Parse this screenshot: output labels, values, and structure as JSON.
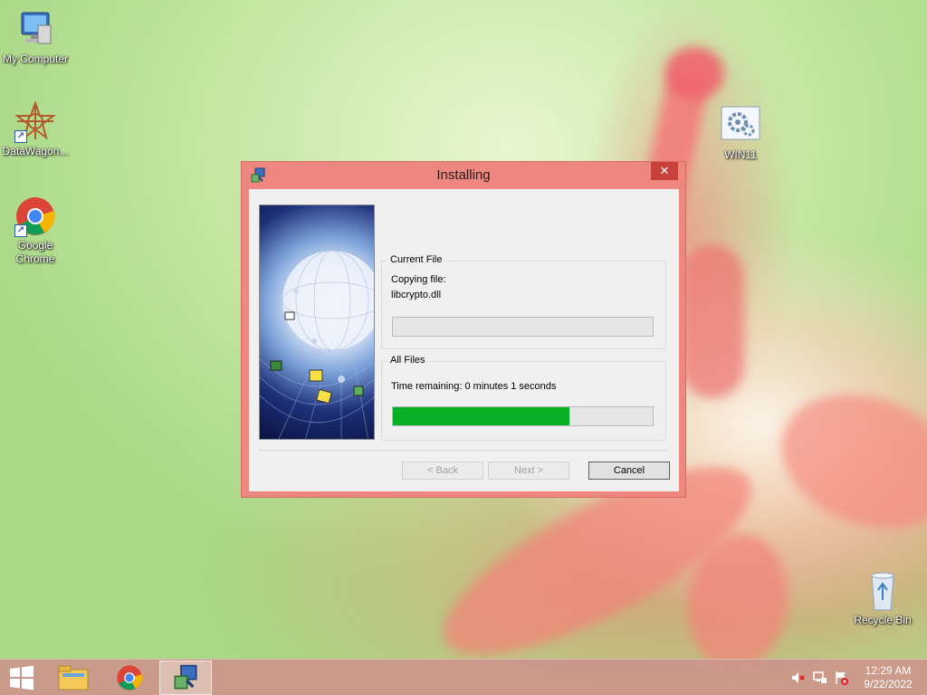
{
  "desktop": {
    "icons": [
      {
        "label": "My Computer",
        "icon": "computer-icon"
      },
      {
        "label": "DataWagon...",
        "icon": "datawagon-icon"
      },
      {
        "label": "Google\nChrome",
        "icon": "chrome-icon"
      },
      {
        "label": "WIN11",
        "icon": "gear-file-icon"
      },
      {
        "label": "Recycle Bin",
        "icon": "recycle-bin-icon"
      }
    ]
  },
  "dialog": {
    "title": "Installing",
    "close_glyph": "✕",
    "current_file": {
      "legend": "Current File",
      "action": "Copying file:",
      "filename": "libcrypto.dll",
      "progress": 0
    },
    "all_files": {
      "legend": "All Files",
      "time_remaining": "Time remaining: 0 minutes 1 seconds",
      "progress": 0.68
    },
    "buttons": {
      "back": "< Back",
      "next": "Next >",
      "cancel": "Cancel"
    }
  },
  "taskbar": {
    "items": [
      "start-icon",
      "file-explorer-icon",
      "chrome-icon",
      "installer-icon"
    ],
    "tray": [
      "volume-muted-icon",
      "network-icon",
      "action-center-icon"
    ],
    "clock": {
      "time": "12:29 AM",
      "date": "9/22/2022"
    }
  },
  "colors": {
    "dialog_frame": "#ee8780",
    "progress_fill": "#06b025",
    "taskbar": "#cc968c"
  }
}
